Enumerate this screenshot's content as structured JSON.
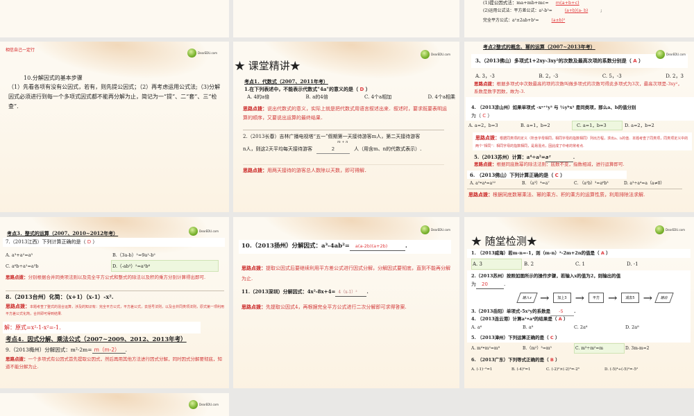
{
  "slide_top_right": {
    "line1": "(1)提公因式法：ma+mb+mc=",
    "ans1": "m(a+b+c)",
    "line2": "(2)运用公式法：平方差公式：a²-b²=",
    "ans2": "(a+b)(a- b)",
    "line3": "完全平方公式：a²±2ab+b²=",
    "ans3": "(a±b)²"
  },
  "slide_steps": {
    "motto": "相信自己一定行",
    "logo": "DearEDU.com",
    "title": "10.分解因式的基本步骤",
    "body": "（1）先看各项有没有公因式，若有，则先提公因式；（2）再考虑运用公式法;（3)分解因式必须进行到每一个多项式因式都不能再分解为止，简记为一“提”、二“套”、三“检查”."
  },
  "slide_lecture": {
    "heading": "★ 课堂精讲★",
    "topic": "考点1．代数式（2007、2011年考）",
    "q1": "1.在下列表述中，不能表示代数式\"4a\"的意义的是（",
    "q1_ans": "D",
    "q1_end": "）",
    "q1_options": [
      "A. 4的a倍",
      "B.  a的4倍",
      "C.  4个a相加",
      "D.  4个a相乘"
    ],
    "hint_label": "思路点拨：",
    "hint1": "说出代数式的意义，实际上就是把代数式用语言叙述出来．叙述时，要求既要表明运算的顺序，又要说出运算的最终结果．",
    "q2a": "2.（2013长春）吉林广播电视塔“五一”假期第一天接待游客m人，第二天接待游客",
    "q2b": "n人，则这2天平均每天接待游客",
    "q2_num": "m + n",
    "q2_den": "2",
    "q2c": "人（用含m、n的代数式表示）.",
    "hint2": "用两天接待的游客总人数除以天数，即可得解．"
  },
  "slide_topic2": {
    "topic": "考点2整式的概念、幂的运算（2007~2013年考）",
    "q3": "3、（2013佛山）多项式1+2xy-3xy²的次数及最高次项的系数分别是（",
    "q3_ans": "A",
    "q3_options": [
      "A. 3，-3",
      "B. 2，-3",
      "C. 5，-3",
      "D. 2，3"
    ],
    "hint3": "根据多项式中次数最高的项的次数叫做多项式的次数可得此多项式为3次，最高次项是-3xy²，系数是数字因数，故为-3.",
    "q4a": "4. （2013凉山州）如果单项式 -xᵃ⁺¹y³ 与 ½yᵇx² 是同类项，那么a、b的值分别",
    "q4b": "为（",
    "q4_ans": "C",
    "q4_options": [
      "A. a=2，b=3",
      "B. a=1，b=2",
      "C. a=1，b=3",
      "D. a=2，b=2"
    ],
    "hint4": "根据同类项的定义（所含字母相同，相同字母的指数相同）列出方程，求出a、b的值．本题考查了同类项，同类项定义中的两个“相同”：相同字母的指数相同，是易混点，因此成了中考的常考点.",
    "q5": "5.（2013苏州）计算：a⁴÷a²=",
    "q5_ans": "a²",
    "hint5": "根据同底数幂的除法法则：底数不变，指数相减，进行运算即可.",
    "q6": "6. （2013佛山）下列计算正确的是（",
    "q6_ans": "C",
    "q6_options": [
      "A. a³•a⁴=a¹²",
      "B. （a³）⁴=a⁷",
      "C. （a²b）³=a⁶b³",
      "D. a³÷a⁴=a（a≠0）"
    ],
    "hint6": "根据同底数幂乘法、幂的乘方、积的乘方的运算性质，利用排除法求解."
  },
  "slide_topic3": {
    "topic": "考点3．整式的运算（2007、2010~2012年考）",
    "q7": "7.（2013江西）下列计算正确的是（",
    "q7_ans": "D",
    "q7_options": [
      "A. a³+a²=a⁵",
      "B.（3a-b）²=9a²-b²",
      "C. a⁶b÷a²=a³b",
      "D.（-ab³）²=a²b⁶"
    ],
    "hint7": "分别根据合并同类项法则以及完全平方公式和整式的除法以及积的乘方分别计算得出即可.",
    "q8": "8.（2013台州）化简：（x+1）（x-1）-x².",
    "hint8": "本题考查了整式的混合运算，涉及的知识有：完全平方公式，平方差公式，去括号法则，以及合并同类项法则，原式第一项利用平方差公式化简，合并即可得到结果.",
    "sol8": "解：原式=x²-1-x²=-1.",
    "topic4": "考点4．因式分解、乘法公式（2007~2009、2012、2013年考）",
    "q9": "9.（2013梅州）分解因式：m²-2m=",
    "q9_ans": "m（m-2）",
    "hint9": "一个多项式有公因式首先提取公因式，然后再用其他方法进行因式分解，同时因式分解要彻底，知道不能分解为止."
  },
  "slide_factor": {
    "q10": "10.（2013扬州）分解因式：a³-4ab²=",
    "q10_ans": "a(a-2b)(a+2b)",
    "hint10": "提取公因式后要继续利用平方差公式进行因式分解，分解因式要彻底，直到不能再分解为止.",
    "q11": "11.（2013深圳）分解因式：4x²-8x+4=",
    "q11_ans": "4（x-1）²",
    "hint11": "先提取公因式4，再根据完全平方公式进行二次分解即可求得答案."
  },
  "slide_quiz": {
    "heading": "★ 随堂检测★",
    "q1": "1. （2013威海）若m-n=-1，则（m-n）²-2m+2n的值是（",
    "q1_ans": "A",
    "q1_options": [
      "A. 3",
      "B. 2",
      "C. 1",
      "D. -1"
    ],
    "q2a": "2.（2013苏州）按照如图所示的操作步骤，若输入x的值为2，则输出的值",
    "q2b": "为",
    "q2_ans": "20",
    "flow": [
      "输入x",
      "加上3",
      "平方",
      "减去5",
      "输出"
    ],
    "q3": "3.（2013岳阳）单项式-5x²y的系数是",
    "q3_ans": "-5",
    "q4": "4. （2013连云港）计算a²•a⁴的结果是（",
    "q4_ans": "A",
    "q4_options": [
      "A. a⁶",
      "B. a⁸",
      "C. 2a⁶",
      "D. 2a⁸"
    ],
    "q5": "5. （2013漳州）下列运算正确的是（",
    "q5_ans": "C",
    "q5_options": [
      "A. m⁴•m²=m⁸",
      "B.（m²）³=m⁵",
      "C. m³÷m²=m",
      "D. 3m-m=2"
    ],
    "q6": "6. （2013广东）下列等式正确的是（",
    "q6_ans": "B",
    "q6_options": [
      "A. (-1)⁻³=1",
      "B. (-4)⁰=1",
      "C. (-2)²×(-2)³=-2⁶",
      "D. (-5)⁴÷(-5)²=-5²"
    ]
  },
  "colors": {
    "background": "#e9e8e6",
    "slide": "#fdf9f1",
    "answer": "#e0383b",
    "hint": "#c81e1e",
    "highlight": "#eef7df"
  }
}
